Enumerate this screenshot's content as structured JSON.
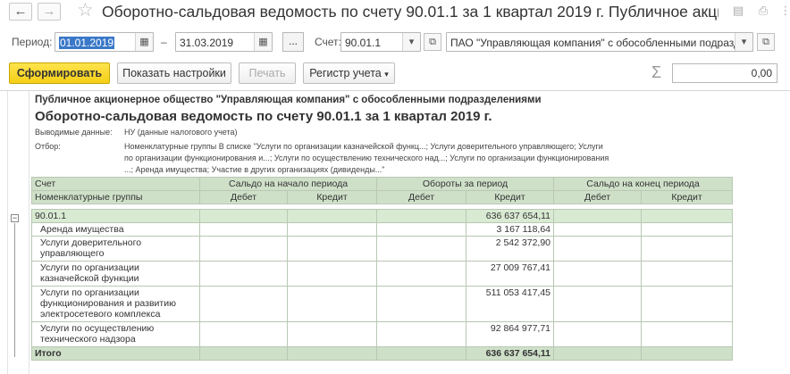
{
  "window": {
    "title": "Оборотно-сальдовая ведомость по счету 90.01.1 за 1 квартал 2019 г. Публичное  акци..."
  },
  "params": {
    "period_label": "Период:",
    "date_from": "01.01.2019",
    "dash": "–",
    "date_to": "31.03.2019",
    "dots_label": "...",
    "account_label": "Счет:",
    "account_value": "90.01.1",
    "organization_value": "ПАО \"Управляющая компания\" с обособленными подразде"
  },
  "toolbar": {
    "generate_label": "Сформировать",
    "settings_label": "Показать настройки",
    "print_label": "Печать",
    "register_label": "Регистр учета",
    "sum_value": "0,00"
  },
  "report": {
    "org_name": "Публичное  акционерное общество  \"Управляющая компания\" с обособленными подразделениями",
    "title": "Оборотно-сальдовая ведомость по счету 90.01.1 за 1 квартал 2019 г.",
    "output_label": "Выводимые данные:",
    "output_value": "НУ (данные налогового учета)",
    "filter_label": "Отбор:",
    "filter_line1": "Номенклатурные группы В списке \"Услуги по организации казначейской функц...; Услуги доверительного управляющего; Услуги",
    "filter_line2": "по организации функционирования и...; Услуги по осуществлению технического над...; Услуги по организации функционирования",
    "filter_line3": "...; Аренда имущества; Участие в других организациях (дивиденды...\"",
    "headers": {
      "account": "Счет",
      "nomenclature": "Номенклатурные группы",
      "opening": "Сальдо на начало периода",
      "turnover": "Обороты за период",
      "closing": "Сальдо на конец периода",
      "debit": "Дебет",
      "credit": "Кредит"
    },
    "group_row": {
      "name": "90.01.1",
      "turnover_credit": "636 637 654,11"
    },
    "rows": [
      {
        "name": "Аренда имущества",
        "turnover_credit": "3 167 118,64"
      },
      {
        "name": "Услуги доверительного управляющего",
        "turnover_credit": "2 542 372,90"
      },
      {
        "name": "Услуги по организации казначейской функции",
        "turnover_credit": "27 009 767,41"
      },
      {
        "name": "Услуги по организации функционирования и развитию электросетевого комплекса",
        "turnover_credit": "511 053 417,45"
      },
      {
        "name": "Услуги по осуществлению технического надзора",
        "turnover_credit": "92 864 977,71"
      }
    ],
    "total_row": {
      "name": "Итого",
      "turnover_credit": "636 637 654,11"
    }
  }
}
